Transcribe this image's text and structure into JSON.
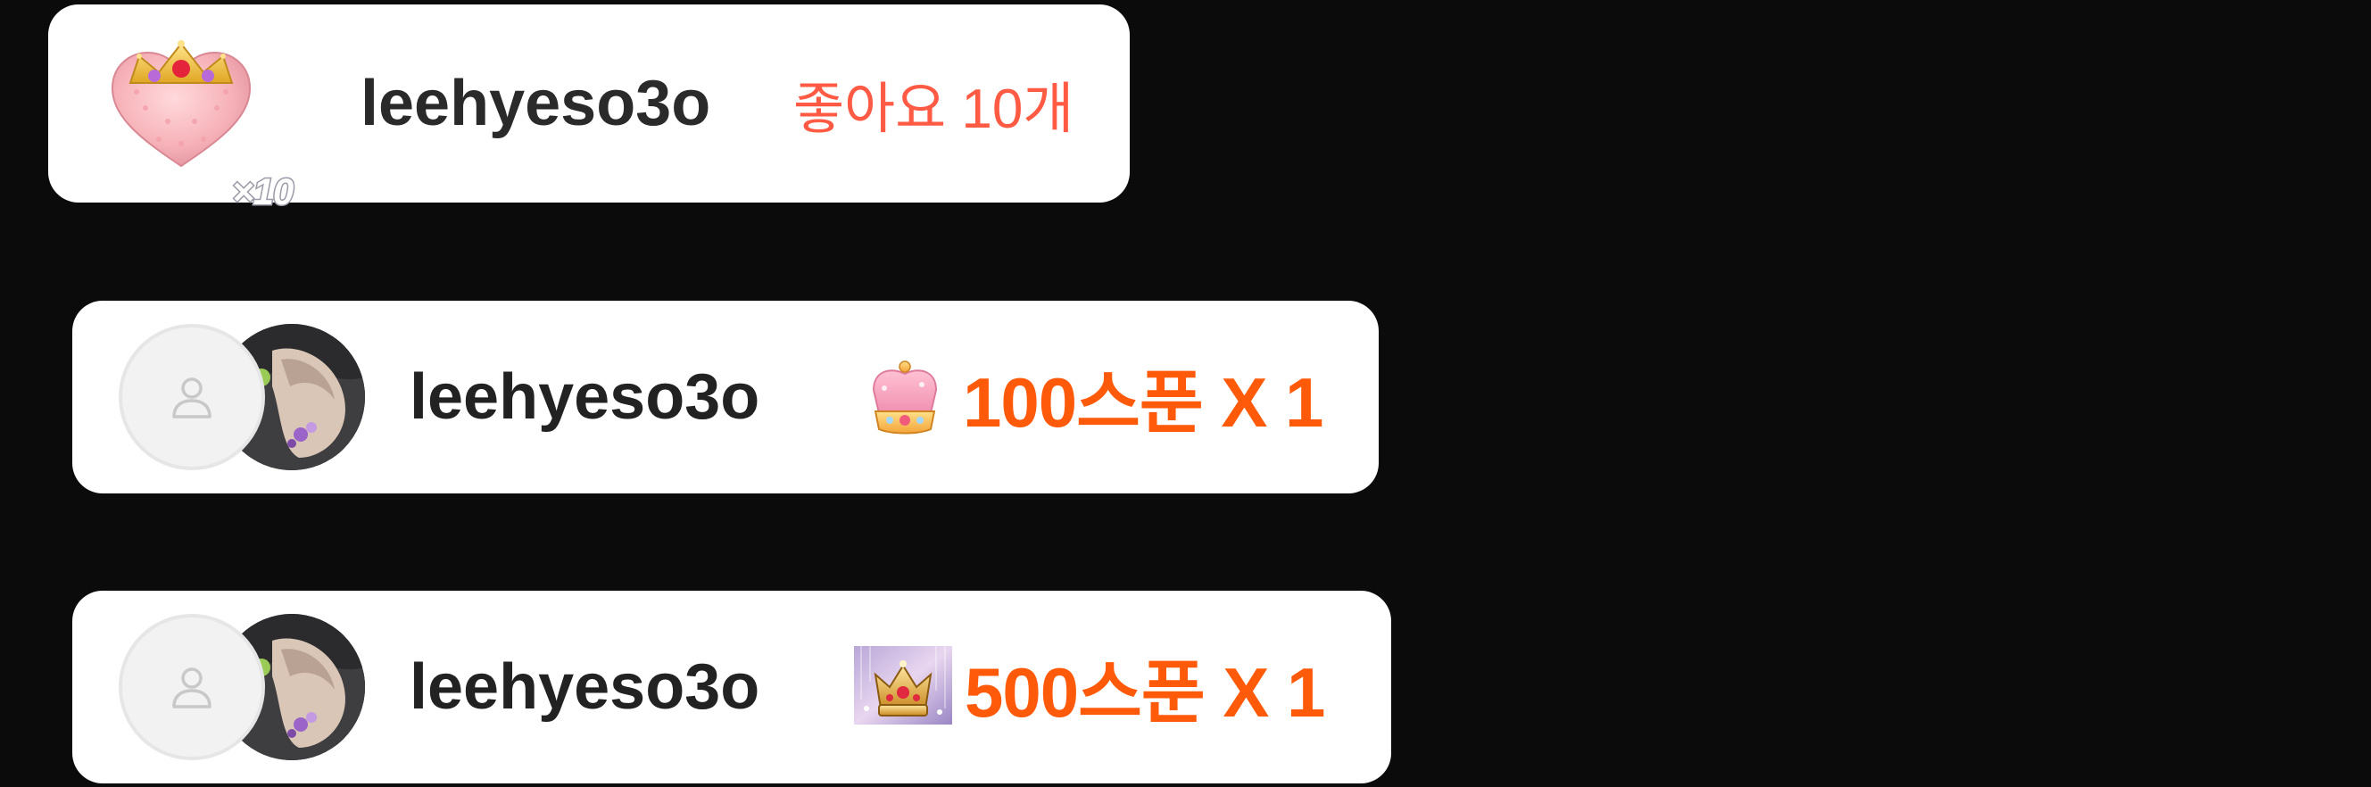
{
  "like_notification": {
    "sticker_icon": "crowned-heart-icon",
    "multiplier": "×10",
    "username": "leehyeso3o",
    "like_text": "좋아요 10개",
    "accent_color": "#ff5a44"
  },
  "gifts": [
    {
      "username": "leehyeso3o",
      "gift_icon": "pink-crown-icon",
      "amount_text": "100스푼 X 1",
      "accent_color": "#ff5a0a"
    },
    {
      "username": "leehyeso3o",
      "gift_icon": "gold-crown-sparkle-icon",
      "amount_text": "500스푼 X 1",
      "accent_color": "#ff5a0a"
    }
  ]
}
